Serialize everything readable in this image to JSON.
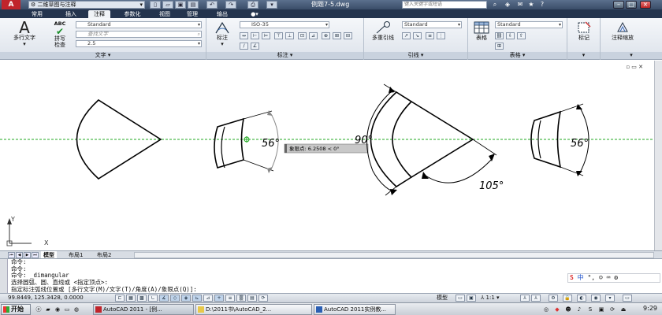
{
  "titlebar": {
    "logo": "A",
    "workspace": "二维草图与注释",
    "doc_title": "例题7-5.dwg",
    "search_placeholder": "键入关键字或短语"
  },
  "tabs": [
    "常用",
    "插入",
    "注释",
    "参数化",
    "视图",
    "管理",
    "输出"
  ],
  "ribbon": {
    "text_panel": {
      "mtext_label": "多行文字",
      "spell_badge": "ABC",
      "spell_label": "拼写检查",
      "style_value": "Standard",
      "find_placeholder": "查找文字",
      "height_value": "2.5",
      "title": "文字"
    },
    "dim_panel": {
      "dim_label": "标注",
      "style_value": "ISO-35",
      "title": "标注"
    },
    "leader_panel": {
      "multileader_label": "多重引线",
      "style_value": "Standard",
      "title": "引线"
    },
    "table_panel": {
      "table_label": "表格",
      "style_value": "Standard",
      "title": "表格"
    },
    "markup_panel": {
      "label": "标记"
    },
    "scale_panel": {
      "label": "注释缩放"
    }
  },
  "drawing": {
    "dim_left": "56°",
    "dim_center_top": "90°",
    "dim_center_bottom": "105°",
    "dim_right": "56°",
    "tooltip": "象限点: 6.2508 < 0°",
    "ucs_y": "Y",
    "ucs_x": "X"
  },
  "layout_tabs": [
    "模型",
    "布局1",
    "布局2"
  ],
  "command": {
    "lines": [
      "命令:",
      "命令:",
      "命令:  _dimangular",
      "选择圆弧、圆、直线或 <指定顶点>:",
      "指定标注弧线位置或 [多行文字(M)/文字(T)/角度(A)/象限点(Q)]:"
    ]
  },
  "ime": {
    "mode": "中"
  },
  "status": {
    "coords": "99.8449,  125.3428,  0.0000",
    "model_label": "模型",
    "scale": "1:1"
  },
  "taskbar": {
    "start": "开始",
    "tasks": [
      "AutoCAD 2011 - [例...",
      "D:\\2011书\\AutoCAD_2...",
      "AutoCAD 2011实例教..."
    ],
    "clock": "9:29"
  }
}
